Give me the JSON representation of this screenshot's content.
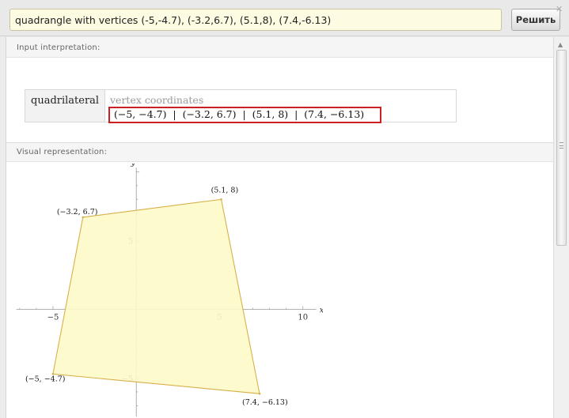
{
  "search": {
    "query": "quadrangle with vertices (-5,-4.7), (-3.2,6.7), (5.1,8), (7.4,-6.13)"
  },
  "solve_button": {
    "label": "Решить"
  },
  "close_icon": "close-icon",
  "pods": {
    "input": {
      "title": "Input interpretation:",
      "label": "quadrilateral",
      "sub_label": "vertex coordinates",
      "values": "(−5, −4.7)  |  (−3.2, 6.7)  |  (5.1, 8)  |  (7.4, −6.13)"
    },
    "visual": {
      "title": "Visual representation:"
    }
  },
  "chart_data": {
    "type": "polygon",
    "vertices": [
      [
        -5,
        -4.7
      ],
      [
        -3.2,
        6.7
      ],
      [
        5.1,
        8
      ],
      [
        7.4,
        -6.13
      ]
    ],
    "vertex_labels": [
      "(−5, −4.7)",
      "(−3.2, 6.7)",
      "(5.1, 8)",
      "(7.4, −6.13)"
    ],
    "xlabel": "x",
    "ylabel": "y",
    "xlim": [
      -7.8,
      11.2
    ],
    "ylim": [
      -7.9,
      10.6
    ],
    "x_ticks": [
      {
        "v": -5,
        "label": "−5"
      },
      {
        "v": 5,
        "label": "5"
      },
      {
        "v": 10,
        "label": "10"
      }
    ],
    "y_ticks": [
      {
        "v": 5,
        "label": "5"
      },
      {
        "v": -5,
        "label": "−5"
      }
    ],
    "fill_color": "#fdfbc9",
    "stroke_color": "#d8b04a"
  }
}
